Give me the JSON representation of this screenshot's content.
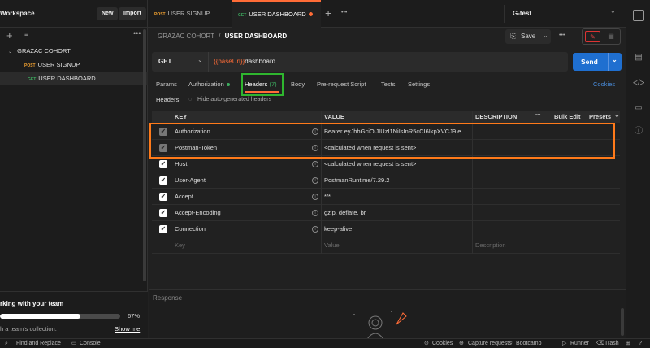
{
  "sidebar": {
    "workspace_title": "Workspace",
    "new_label": "New",
    "import_label": "Import",
    "collection_name": "GRAZAC COHORT",
    "items": [
      {
        "method": "POST",
        "name": "USER SIGNUP"
      },
      {
        "method": "GET",
        "name": "USER DASHBOARD"
      }
    ],
    "onboarding": {
      "title": "rking with your team",
      "subtitle": "h a team's collection.",
      "percent_label": "67%",
      "progress": 0.67,
      "show_me": "Show me"
    }
  },
  "tabs": [
    {
      "method": "POST",
      "name": "USER SIGNUP"
    },
    {
      "method": "GET",
      "name": "USER DASHBOARD"
    }
  ],
  "environment": "G-test",
  "breadcrumb": {
    "parent": "GRAZAC COHORT",
    "separator": "/",
    "current": "USER DASHBOARD"
  },
  "save_label": "Save",
  "request": {
    "method": "GET",
    "url_var": "{{baseUrl}}",
    "url_path": "dashboard"
  },
  "send_label": "Send",
  "request_tabs": [
    "Params",
    "Authorization",
    "Headers",
    "(7)",
    "Body",
    "Pre-request Script",
    "Tests",
    "Settings"
  ],
  "cookies_label": "Cookies",
  "headers_sub": {
    "label": "Headers",
    "hide_label": "Hide auto-generated headers"
  },
  "table": {
    "columns": [
      "KEY",
      "VALUE",
      "DESCRIPTION"
    ],
    "bulk_edit": "Bulk Edit",
    "presets": "Presets",
    "rows": [
      {
        "key": "Authorization",
        "value": "Bearer eyJhbGciOiJIUzI1NiIsInR5cCI6IkpXVCJ9.e...",
        "disabled": true
      },
      {
        "key": "Postman-Token",
        "value": "<calculated when request is sent>",
        "disabled": true
      },
      {
        "key": "Host",
        "value": "<calculated when request is sent>",
        "disabled": false
      },
      {
        "key": "User-Agent",
        "value": "PostmanRuntime/7.29.2",
        "disabled": false
      },
      {
        "key": "Accept",
        "value": "*/*",
        "disabled": false
      },
      {
        "key": "Accept-Encoding",
        "value": "gzip, deflate, br",
        "disabled": false
      },
      {
        "key": "Connection",
        "value": "keep-alive",
        "disabled": false
      }
    ],
    "placeholder": {
      "key": "Key",
      "value": "Value",
      "description": "Description"
    }
  },
  "response_label": "Response",
  "statusbar": {
    "find_replace": "Find and Replace",
    "console": "Console",
    "cookies": "Cookies",
    "capture": "Capture requests",
    "bootcamp": "Bootcamp",
    "runner": "Runner",
    "trash": "Trash"
  },
  "colors": {
    "accent": "#ff6c37",
    "send": "#1f6fd0",
    "get": "#3dac5f",
    "post": "#f0a030",
    "highlight_green": "#2fb62f",
    "highlight_orange": "#ff7a1a"
  }
}
